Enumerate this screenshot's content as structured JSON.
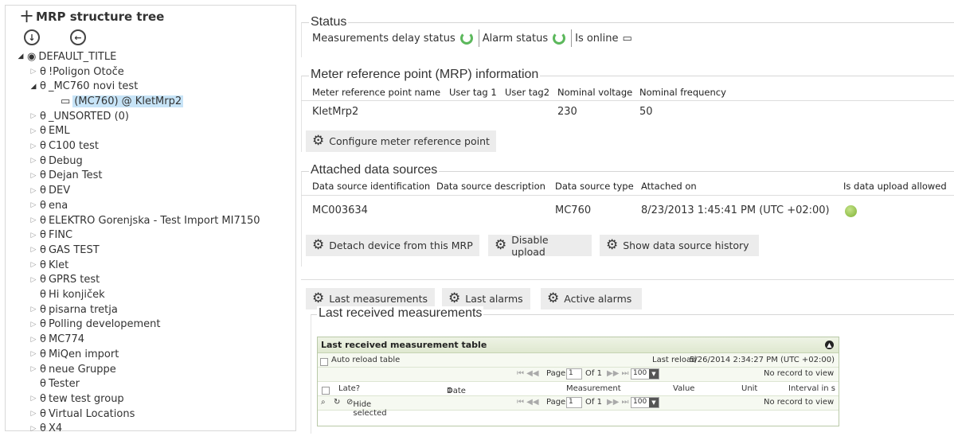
{
  "tree": {
    "title": "MRP structure tree",
    "root": "DEFAULT_TITLE",
    "items": [
      {
        "label": "!Poligon Otoče"
      },
      {
        "label": "_MC760 novi test"
      },
      {
        "label": "(MC760) @ KletMrp2"
      },
      {
        "label": "_UNSORTED (0)"
      },
      {
        "label": "EML"
      },
      {
        "label": "C100 test"
      },
      {
        "label": "Debug"
      },
      {
        "label": "Dejan Test"
      },
      {
        "label": "DEV"
      },
      {
        "label": "ena"
      },
      {
        "label": "ELEKTRO Gorenjska - Test Import MI7150"
      },
      {
        "label": "FINC"
      },
      {
        "label": "GAS TEST"
      },
      {
        "label": "Klet"
      },
      {
        "label": "GPRS test"
      },
      {
        "label": "Hi konjiček"
      },
      {
        "label": "pisarna tretja"
      },
      {
        "label": "Polling developement"
      },
      {
        "label": "MC774"
      },
      {
        "label": "MiQen import"
      },
      {
        "label": "neue Gruppe"
      },
      {
        "label": "Tester"
      },
      {
        "label": "tew test group"
      },
      {
        "label": "Virtual Locations"
      },
      {
        "label": "X4"
      }
    ]
  },
  "status": {
    "legend": "Status",
    "delay_label": "Measurements delay status",
    "alarm_label": "Alarm status",
    "online_label": "Is online"
  },
  "mrp": {
    "legend": "Meter reference point (MRP) information",
    "headers": [
      "Meter reference point name",
      "User tag 1",
      "User tag2",
      "Nominal voltage",
      "Nominal frequency"
    ],
    "name": "KletMrp2",
    "voltage": "230",
    "frequency": "50",
    "configure_btn": "Configure meter reference point"
  },
  "sources": {
    "legend": "Attached data sources",
    "headers": [
      "Data source identification",
      "Data source description",
      "Data source type",
      "Attached on",
      "Is data upload allowed"
    ],
    "id": "MC003634",
    "type": "MC760",
    "attached": "8/23/2013 1:45:41 PM (UTC +02:00)",
    "detach_btn": "Detach device from this MRP",
    "disable_btn": "Disable upload",
    "history_btn": "Show data source history"
  },
  "actions": {
    "last_meas_btn": "Last measurements",
    "last_alarms_btn": "Last alarms",
    "active_alarms_btn": "Active alarms"
  },
  "measurements": {
    "legend": "Last received measurements",
    "table_title": "Last received measurement table",
    "auto_reload": "Auto reload table",
    "last_reload_label": "Last reload",
    "last_reload_value": "5/26/2014 2:34:27 PM (UTC +02:00)",
    "page_label": "Page",
    "page_value": "1",
    "of_label": "Of 1",
    "page_size": "100",
    "no_record": "No record to view",
    "columns": [
      "Late?",
      "Date",
      "Measurement",
      "Value",
      "Unit",
      "Interval in s"
    ],
    "hide_selected": "Hide selected"
  },
  "colors": {
    "accent_green": "#5cb85c",
    "selection": "#c7e4f7"
  }
}
